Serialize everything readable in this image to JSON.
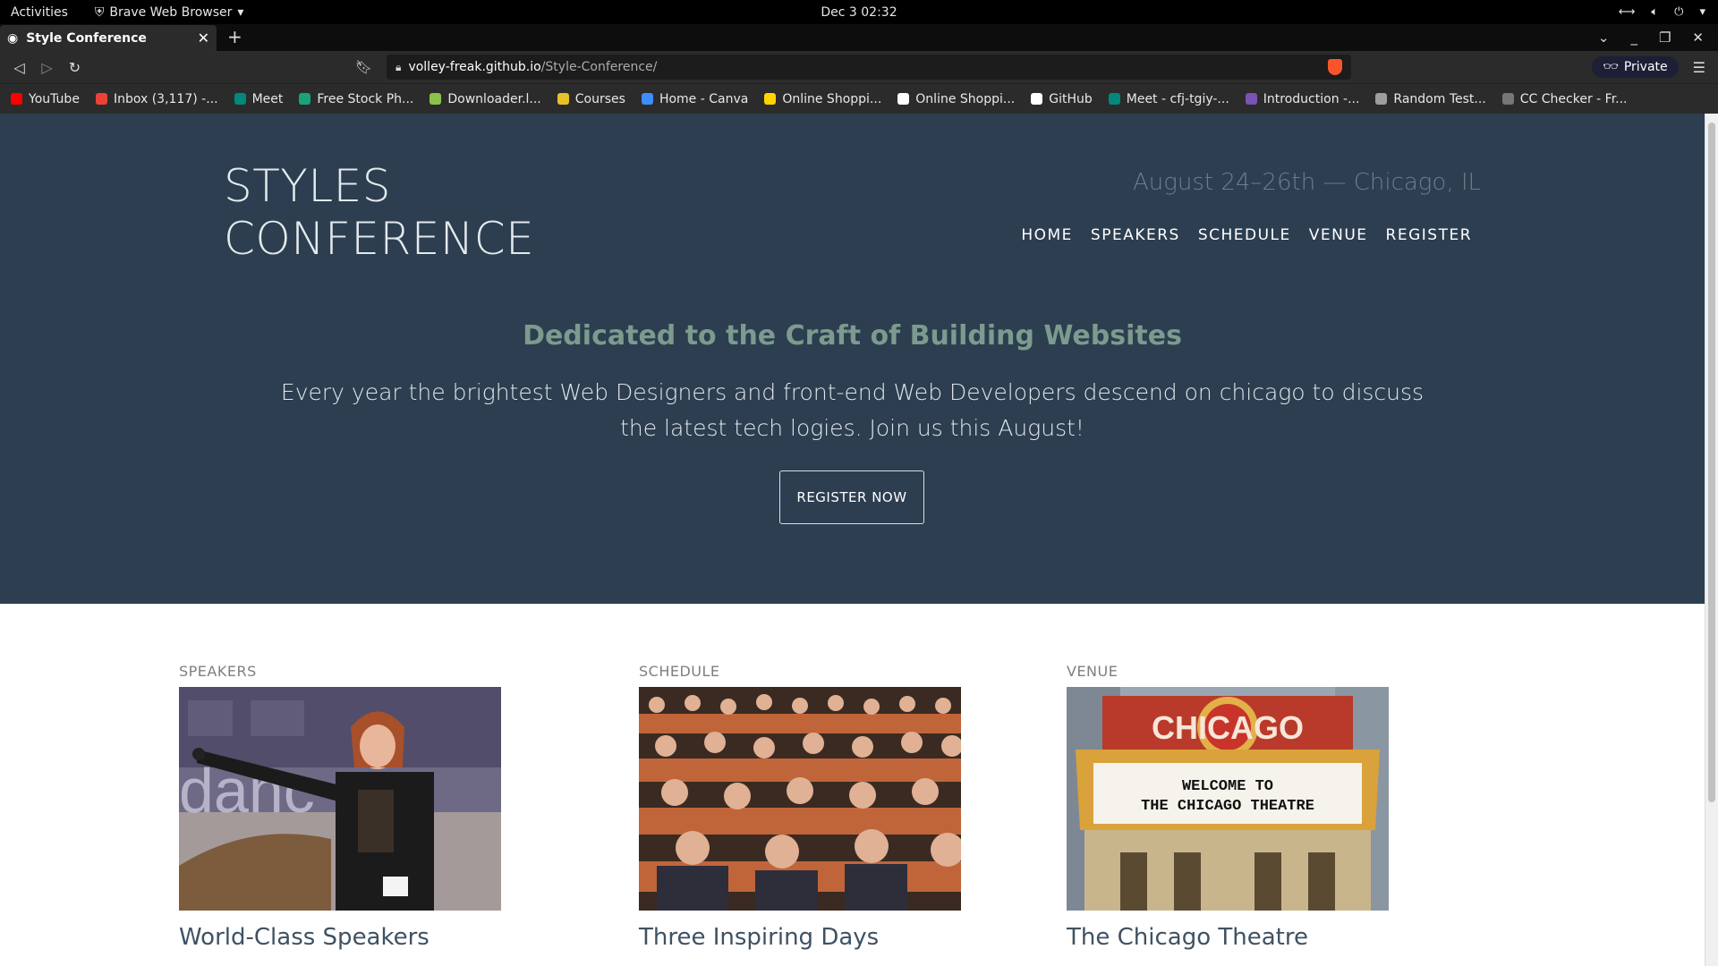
{
  "system": {
    "activities": "Activities",
    "app_name": "Brave Web Browser",
    "clock": "Dec 3  02:32"
  },
  "browser": {
    "tab_title": "Style Conference",
    "url_host": "volley-freak.github.io",
    "url_path": "/Style-Conference/",
    "private_label": "Private",
    "bookmarks": [
      {
        "label": "YouTube",
        "icon": "youtube-icon",
        "color": "#ff0000"
      },
      {
        "label": "Inbox (3,117) -...",
        "icon": "gmail-icon",
        "color": "#ea4335"
      },
      {
        "label": "Meet",
        "icon": "meet-icon",
        "color": "#00897b"
      },
      {
        "label": "Free Stock Ph...",
        "icon": "stock-photo-icon",
        "color": "#1aa37a"
      },
      {
        "label": "Downloader.l...",
        "icon": "downloader-icon",
        "color": "#8bc34a"
      },
      {
        "label": "Courses",
        "icon": "courses-icon",
        "color": "#e6c229"
      },
      {
        "label": "Home - Canva",
        "icon": "canva-icon",
        "color": "#3f8cff"
      },
      {
        "label": "Online Shoppi...",
        "icon": "flipkart-icon",
        "color": "#ffd400"
      },
      {
        "label": "Online Shoppi...",
        "icon": "amazon-icon",
        "color": "#ffffff"
      },
      {
        "label": "GitHub",
        "icon": "github-icon",
        "color": "#ffffff"
      },
      {
        "label": "Meet - cfj-tgiy-...",
        "icon": "meet-icon",
        "color": "#00897b"
      },
      {
        "label": "Introduction -...",
        "icon": "bootstrap-icon",
        "color": "#7952b3"
      },
      {
        "label": "Random Test...",
        "icon": "gear-icon",
        "color": "#9e9e9e"
      },
      {
        "label": "CC Checker - Fr...",
        "icon": "cc-checker-icon",
        "color": "#777777"
      }
    ]
  },
  "site": {
    "logo_line1": "STYLES",
    "logo_line2": "CONFERENCE",
    "tagline": "August 24–26th — Chicago, IL",
    "nav": [
      "HOME",
      "SPEAKERS",
      "SCHEDULE",
      "VENUE",
      "REGISTER"
    ],
    "hero_heading": "Dedicated to the Craft of Building Websites",
    "hero_text": "Every year the brightest Web Designers and front-end Web Developers descend on chicago to discuss the latest tech logies. Join us this August!",
    "cta_label": "REGISTER NOW",
    "cards": [
      {
        "section": "SPEAKERS",
        "title": "World-Class Speakers"
      },
      {
        "section": "SCHEDULE",
        "title": "Three Inspiring Days"
      },
      {
        "section": "VENUE",
        "title": "The Chicago Theatre"
      }
    ],
    "colors": {
      "hero_bg": "#2c3e50",
      "accent_heading": "#7c9a8e",
      "card_title": "#3e5263"
    }
  }
}
